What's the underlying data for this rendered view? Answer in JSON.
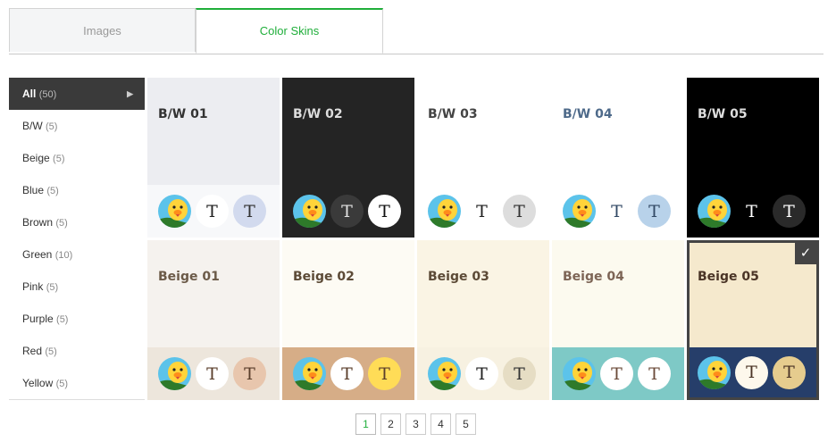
{
  "tabs": [
    {
      "label": "Images"
    },
    {
      "label": "Color Skins"
    }
  ],
  "sidebar": {
    "items": [
      {
        "label": "All",
        "count": "(50)"
      },
      {
        "label": "B/W",
        "count": "(5)"
      },
      {
        "label": "Beige",
        "count": "(5)"
      },
      {
        "label": "Blue",
        "count": "(5)"
      },
      {
        "label": "Brown",
        "count": "(5)"
      },
      {
        "label": "Green",
        "count": "(10)"
      },
      {
        "label": "Pink",
        "count": "(5)"
      },
      {
        "label": "Purple",
        "count": "(5)"
      },
      {
        "label": "Red",
        "count": "(5)"
      },
      {
        "label": "Yellow",
        "count": "(5)"
      }
    ],
    "arrow_icon": "chevron-right-icon"
  },
  "skins": [
    {
      "name": "B/W 01",
      "top_bg": "#ecedf1",
      "title_color": "#333333",
      "bottom_bg": "#f7f8fa",
      "c1_bg": "#ffffff",
      "c1_fg": "#222222",
      "c2_bg": "#d2daee",
      "c2_fg": "#333333"
    },
    {
      "name": "B/W 02",
      "top_bg": "#242424",
      "title_color": "#dddddd",
      "bottom_bg": "#242424",
      "c1_bg": "#3a3a3a",
      "c1_fg": "#e0e0e0",
      "c2_bg": "#ffffff",
      "c2_fg": "#111111"
    },
    {
      "name": "B/W 03",
      "top_bg": "#ffffff",
      "title_color": "#444444",
      "bottom_bg": "#ffffff",
      "c1_bg": "#ffffff",
      "c1_fg": "#222222",
      "c2_bg": "#dddddd",
      "c2_fg": "#333333"
    },
    {
      "name": "B/W 04",
      "top_bg": "#ffffff",
      "title_color": "#4e6a8a",
      "bottom_bg": "#ffffff",
      "c1_bg": "#ffffff",
      "c1_fg": "#334a66",
      "c2_bg": "#b8d2ea",
      "c2_fg": "#334a66"
    },
    {
      "name": "B/W 05",
      "top_bg": "#000000",
      "title_color": "#dddddd",
      "bottom_bg": "#000000",
      "c1_bg": "#000000",
      "c1_fg": "#ffffff",
      "c2_bg": "#2a2a2a",
      "c2_fg": "#ffffff"
    },
    {
      "name": "Beige 01",
      "top_bg": "#f5f2ee",
      "title_color": "#6b5a48",
      "bottom_bg": "#ede6dc",
      "c1_bg": "#ffffff",
      "c1_fg": "#5a3e2b",
      "c2_bg": "#e8c6ad",
      "c2_fg": "#5a3e2b"
    },
    {
      "name": "Beige 02",
      "top_bg": "#fdfbf4",
      "title_color": "#5c4a36",
      "bottom_bg": "#d6ad87",
      "c1_bg": "#ffffff",
      "c1_fg": "#5a3e2b",
      "c2_bg": "#ffdc57",
      "c2_fg": "#5a3e2b"
    },
    {
      "name": "Beige 03",
      "top_bg": "#faf4e4",
      "title_color": "#5c4a36",
      "bottom_bg": "#f7f1e1",
      "c1_bg": "#ffffff",
      "c1_fg": "#222222",
      "c2_bg": "#e6ddc4",
      "c2_fg": "#333333"
    },
    {
      "name": "Beige 04",
      "top_bg": "#fcfaef",
      "title_color": "#7d6556",
      "bottom_bg": "#7ec9c6",
      "c1_bg": "#ffffff",
      "c1_fg": "#6b4b3a",
      "c2_bg": "#ffffff",
      "c2_fg": "#6b4b3a"
    },
    {
      "name": "Beige 05",
      "top_bg": "#f5e9cd",
      "title_color": "#4a3426",
      "bottom_bg": "#263e6a",
      "c1_bg": "#fdf8ec",
      "c1_fg": "#4a3426",
      "c2_bg": "#e6cc8e",
      "c2_fg": "#4a3426",
      "selected": true
    }
  ],
  "avatar_icon": "sally-duck-icon",
  "text_sample": "T",
  "check_icon": "checkmark-icon",
  "pagination": {
    "current": "1",
    "pages": [
      "1",
      "2",
      "3",
      "4",
      "5"
    ]
  }
}
